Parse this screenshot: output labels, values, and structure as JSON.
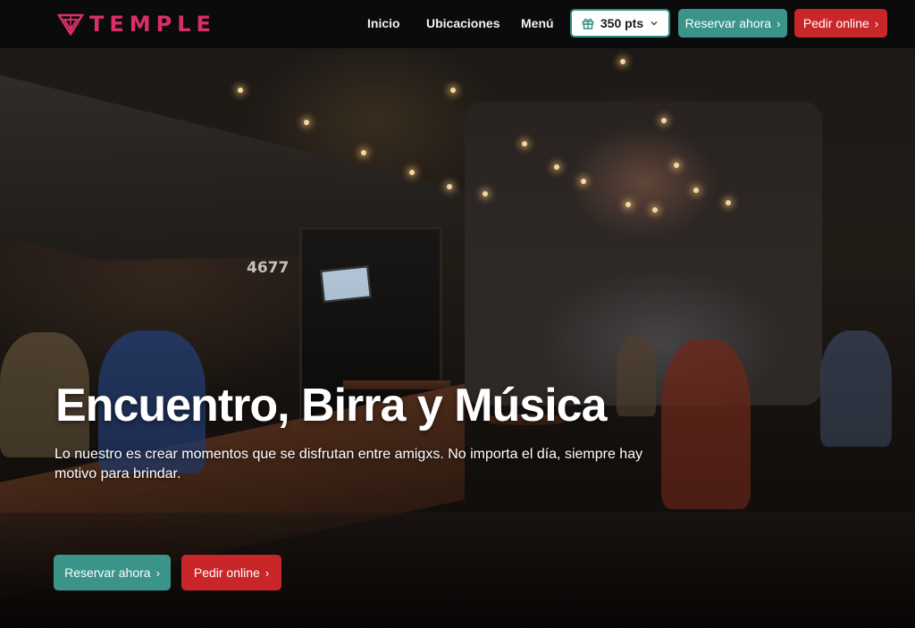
{
  "brand": {
    "name": "TEMPLE",
    "color": "#d92e6b"
  },
  "nav": {
    "links": [
      {
        "label": "Inicio"
      },
      {
        "label": "Ubicaciones"
      },
      {
        "label": "Menú"
      }
    ],
    "points": {
      "label": "350 pts",
      "icon": "gift-icon"
    },
    "reserve": {
      "label": "Reservar ahora"
    },
    "order": {
      "label": "Pedir online"
    }
  },
  "hero": {
    "title": "Encuentro, Birra y Música",
    "subtitle": "Lo nuestro es crear momentos que se disfrutan entre amigxs. No importa el día, siempre hay motivo para brindar.",
    "address_sign": "4677",
    "reserve": {
      "label": "Reservar ahora"
    },
    "order": {
      "label": "Pedir online"
    }
  },
  "colors": {
    "teal": "#3a9488",
    "red": "#c9262a",
    "nav_bg": "#0b0b0b"
  }
}
